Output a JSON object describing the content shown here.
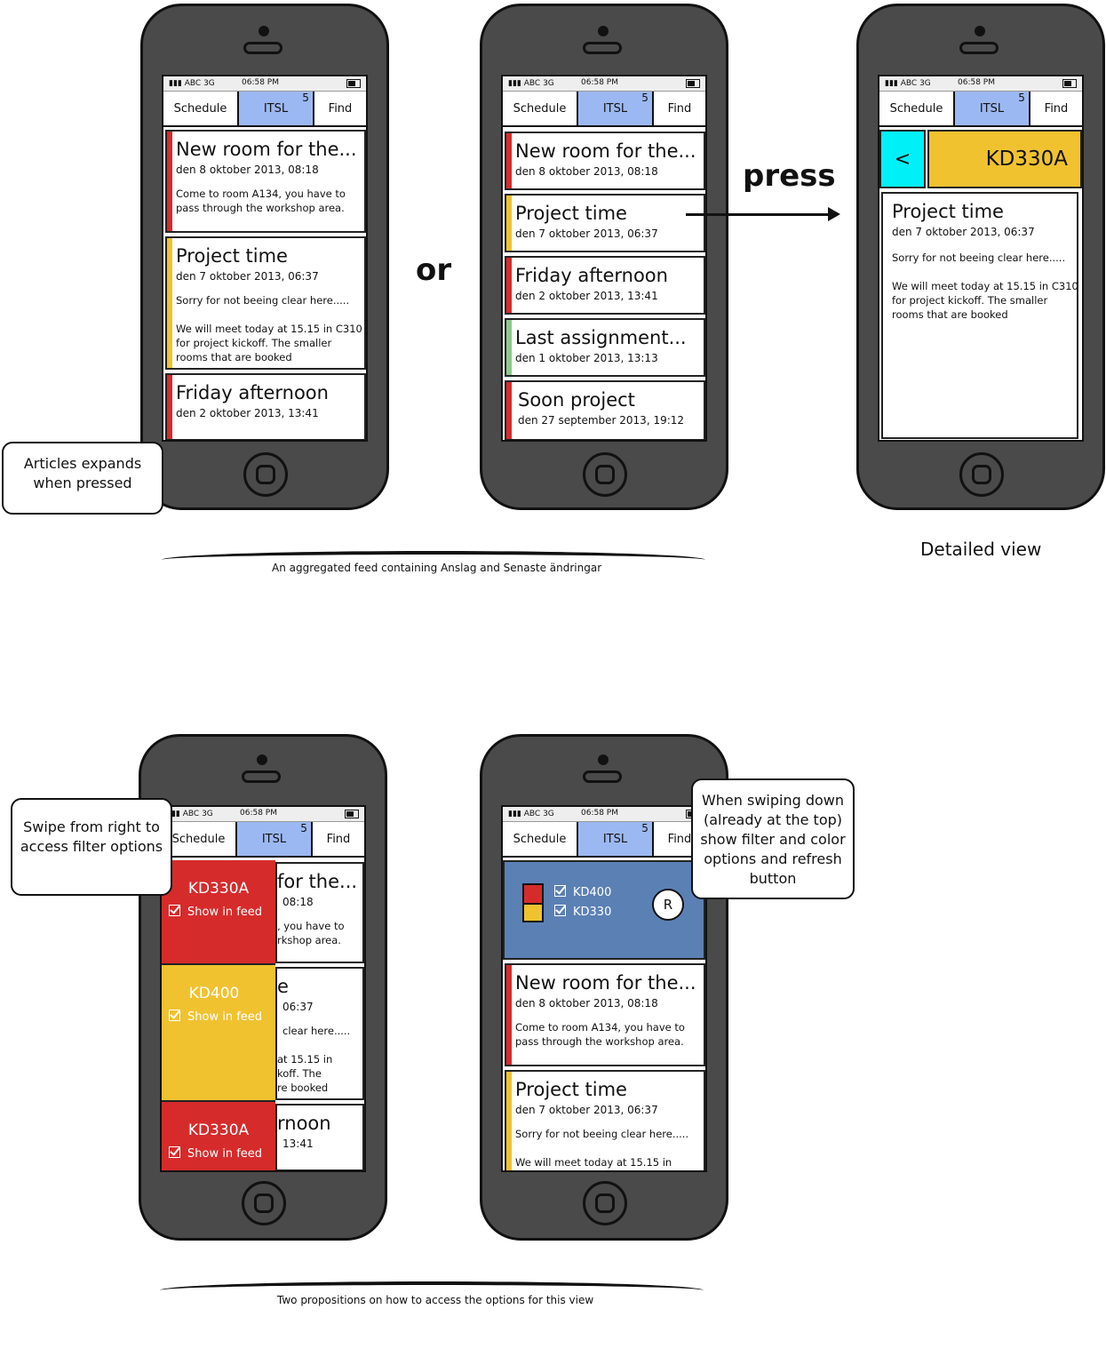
{
  "status": {
    "carrier": "ABC",
    "network": "3G",
    "time": "06:58 PM"
  },
  "tabs": {
    "schedule": "Schedule",
    "itsl": "ITSL",
    "badge": "5",
    "find": "Find"
  },
  "colors": {
    "red": "#d62b2b",
    "yellow": "#f0c230",
    "green": "#8cc98a",
    "blue": "#9cb8f2",
    "cyan": "#00f0f8",
    "panel": "#5b80b4"
  },
  "notes": {
    "articles": "Articles expands when pressed",
    "swipe": "Swipe from right to access filter options",
    "swipe_down": "When swiping down (already at the top) show filter and color options and refresh button"
  },
  "labels": {
    "or": "or",
    "press": "press",
    "detailed": "Detailed view",
    "caption_top": "An aggregated feed containing Anslag and Senaste ändringar",
    "caption_bottom": "Two propositions on how to access the options for this view"
  },
  "phone1": {
    "cards": [
      {
        "title": "New room for the...",
        "date": "den 8 oktober 2013, 08:18",
        "body": "Come to room A134, you have to pass through the workshop area."
      },
      {
        "title": "Project time",
        "date": "den 7 oktober 2013, 06:37",
        "body1": "Sorry for not beeing clear here.....",
        "body2": "We will meet today at 15.15 in C310 for project kickoff. The smaller rooms that are booked"
      },
      {
        "title": "Friday afternoon",
        "date": "den 2 oktober 2013, 13:41"
      }
    ]
  },
  "phone2": {
    "cards": [
      {
        "title": "New room for the...",
        "date": "den 8 oktober 2013, 08:18"
      },
      {
        "title": "Project time",
        "date": "den 7 oktober 2013, 06:37"
      },
      {
        "title": "Friday afternoon",
        "date": "den 2 oktober 2013, 13:41"
      },
      {
        "title": "Last assignment...",
        "date": "den 1 oktober 2013, 13:13"
      },
      {
        "title": "Soon project",
        "date": "den 27 september 2013, 19:12"
      }
    ]
  },
  "phone3": {
    "back": "<",
    "course": "KD330A",
    "title": "Project time",
    "date": "den 7 oktober 2013, 06:37",
    "body1": "Sorry for not beeing clear here.....",
    "body2": "We will meet today at 15.15 in C310 for project kickoff. The smaller rooms that are booked"
  },
  "phone4": {
    "filters": [
      {
        "name": "KD330A",
        "show": "Show in feed"
      },
      {
        "name": "KD400",
        "show": "Show in feed"
      },
      {
        "name": "KD330A",
        "show": "Show in feed"
      }
    ],
    "peek": [
      {
        "t": "for the...",
        "d": "08:18",
        "b": ", you have to\nrkshop area."
      },
      {
        "t": "e",
        "d": "06:37",
        "b": "clear here.....",
        "b2": "at 15.15 in\nkoff. The\nre booked"
      },
      {
        "t": "rnoon",
        "d": "13:41"
      }
    ]
  },
  "phone5": {
    "options": [
      "KD400",
      "KD330"
    ],
    "refresh": "R",
    "cards": [
      {
        "title": "New room for the...",
        "date": "den 8 oktober 2013, 08:18",
        "body": "Come to room A134, you have to pass through the workshop area."
      },
      {
        "title": "Project time",
        "date": "den 7 oktober 2013, 06:37",
        "body1": "Sorry for not beeing clear here.....",
        "body2": "We will meet today at 15.15 in"
      }
    ]
  }
}
